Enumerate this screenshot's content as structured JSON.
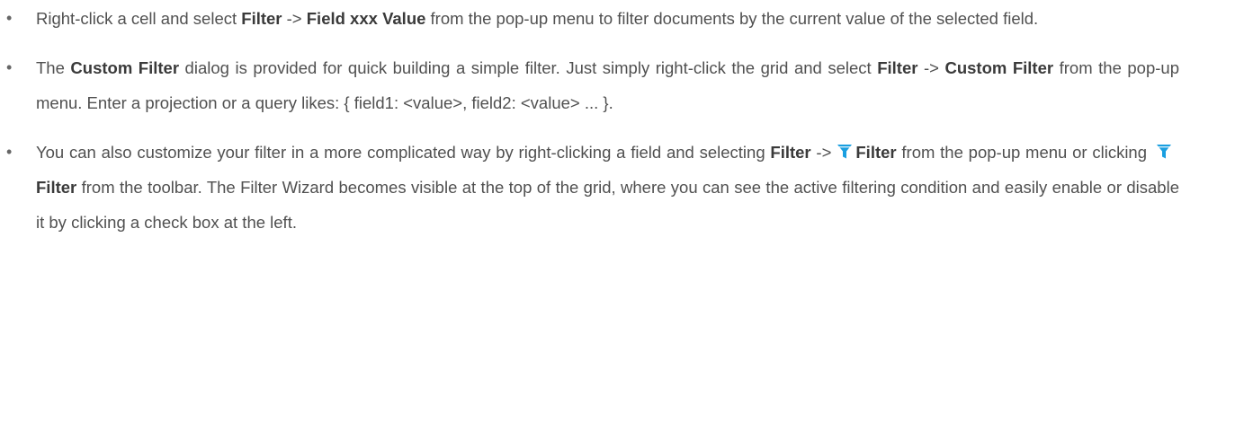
{
  "icons": {
    "filter": "filter-funnel-icon",
    "filter_color": "#1a9fe0",
    "filter_band_color": "#ffffff"
  },
  "bullets": [
    {
      "t1": "Right-click a cell and select ",
      "b1": "Filter",
      "t2": " -> ",
      "b2": "Field xxx Value",
      "t3": " from the pop-up menu to filter documents by the current value of the selected field."
    },
    {
      "t1": "The ",
      "b1": "Custom Filter",
      "t2": " dialog is provided for quick building a simple filter. Just simply right-click the grid and select ",
      "b2": "Filter",
      "t3": " -> ",
      "b3": "Custom Filter",
      "t4": " from the pop-up menu. Enter a projection or a query likes: { field1: <value>, field2: <value> ... }."
    },
    {
      "t1": "You can also customize your filter in a more complicated way by right-clicking a field and selecting ",
      "b1": "Filter",
      "t2": " ->",
      "b2": "Filter",
      "t3": " from the pop-up menu or clicking",
      "b3": "Filter",
      "t4": " from the toolbar. The Filter Wizard becomes visible at the top of the grid, where you can see the active filtering condition and easily enable or disable it by clicking a check box at the left."
    }
  ]
}
